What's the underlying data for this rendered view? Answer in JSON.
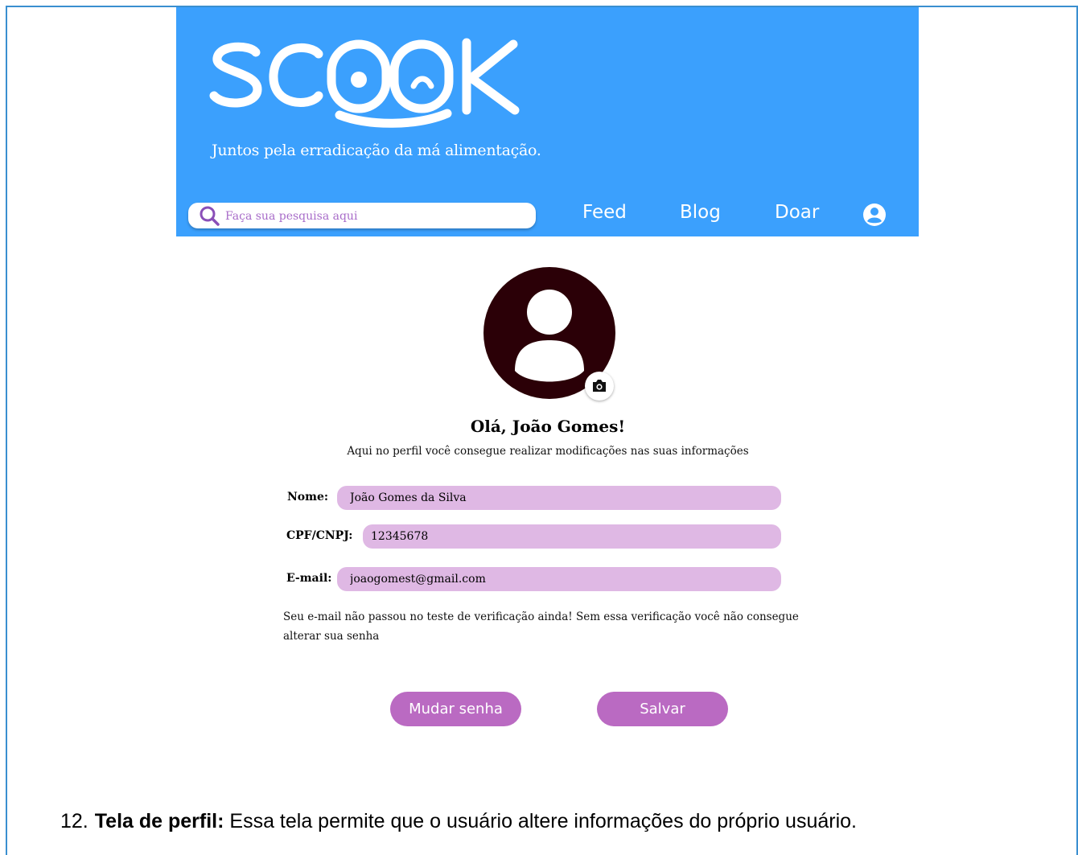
{
  "header": {
    "logo_text": "SCOOK",
    "tagline": "Juntos pela erradicação da má alimentação.",
    "search_placeholder": "Faça sua pesquisa aqui",
    "nav": [
      "Feed",
      "Blog",
      "Doar"
    ],
    "colors": {
      "header_bg": "#3ba0fd",
      "accent_purple": "#ba6ac2",
      "field_bg": "#dfb8e4"
    },
    "icons": [
      "search-icon",
      "user-circle-icon"
    ]
  },
  "profile": {
    "greeting": "Olá, João Gomes!",
    "subtitle": "Aqui no perfil você consegue realizar modificações nas suas informações",
    "icons": [
      "avatar-icon",
      "camera-icon"
    ],
    "fields": [
      {
        "label": "Nome:",
        "value": "João Gomes da Silva"
      },
      {
        "label": "CPF/CNPJ:",
        "value": "12345678"
      },
      {
        "label": "E-mail:",
        "value": "joaogomest@gmail.com"
      }
    ],
    "warning": "Seu e-mail não passou no teste de verificação ainda! Sem essa verificação você não consegue alterar sua senha",
    "buttons": {
      "change_password": "Mudar senha",
      "save": "Salvar"
    }
  },
  "caption": {
    "number": "12.",
    "title": "Tela de perfil:",
    "text": " Essa tela permite que o usuário altere informações do próprio usuário."
  }
}
